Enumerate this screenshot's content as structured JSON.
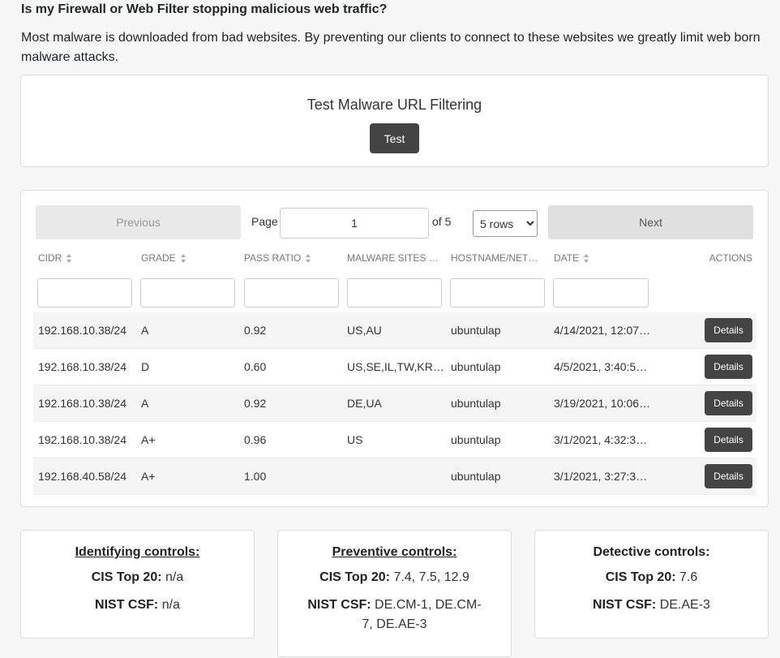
{
  "heading": "Is my Firewall or Web Filter stopping malicious web traffic?",
  "intro": "Most malware is downloaded from bad websites. By preventing our clients to connect to these websites we greatly limit web born malware attacks.",
  "test_card": {
    "title": "Test Malware URL Filtering",
    "button": "Test"
  },
  "pager": {
    "previous": "Previous",
    "page_label": "Page",
    "page_value": "1",
    "of_label": "of 5",
    "rows_option": "5 rows",
    "next": "Next"
  },
  "table": {
    "headers": [
      "CIDR",
      "GRADE",
      "PASS RATIO",
      "MALWARE SITES GE…",
      "HOSTNAME/NETW…",
      "DATE",
      "ACTIONS"
    ],
    "rows": [
      {
        "cidr": "192.168.10.38/24",
        "grade": "A",
        "pass": "0.92",
        "sites": "US,AU",
        "host": "ubuntulap",
        "date": "4/14/2021, 12:07…",
        "action": "Details"
      },
      {
        "cidr": "192.168.10.38/24",
        "grade": "D",
        "pass": "0.60",
        "sites": "US,SE,IL,TW,KR,BZ",
        "host": "ubuntulap",
        "date": "4/5/2021, 3:40:5…",
        "action": "Details"
      },
      {
        "cidr": "192.168.10.38/24",
        "grade": "A",
        "pass": "0.92",
        "sites": "DE,UA",
        "host": "ubuntulap",
        "date": "3/19/2021, 10:06…",
        "action": "Details"
      },
      {
        "cidr": "192.168.10.38/24",
        "grade": "A+",
        "pass": "0.96",
        "sites": "US",
        "host": "ubuntulap",
        "date": "3/1/2021, 4:32:3…",
        "action": "Details"
      },
      {
        "cidr": "192.168.40.58/24",
        "grade": "A+",
        "pass": "1.00",
        "sites": "",
        "host": "ubuntulap",
        "date": "3/1/2021, 3:27:3…",
        "action": "Details"
      }
    ]
  },
  "controls": [
    {
      "title": "Identifying controls:",
      "cis_label": "CIS Top 20:",
      "cis": "n/a",
      "nist_label": "NIST CSF:",
      "nist": "n/a"
    },
    {
      "title": "Preventive controls:",
      "cis_label": "CIS Top 20:",
      "cis": "7.4, 7.5, 12.9",
      "nist_label": "NIST CSF:",
      "nist": "DE.CM-1, DE.CM-7, DE.AE-3"
    },
    {
      "title": "Detective controls:",
      "cis_label": "CIS Top 20:",
      "cis": "7.6",
      "nist_label": "NIST CSF:",
      "nist": "DE.AE-3"
    }
  ]
}
